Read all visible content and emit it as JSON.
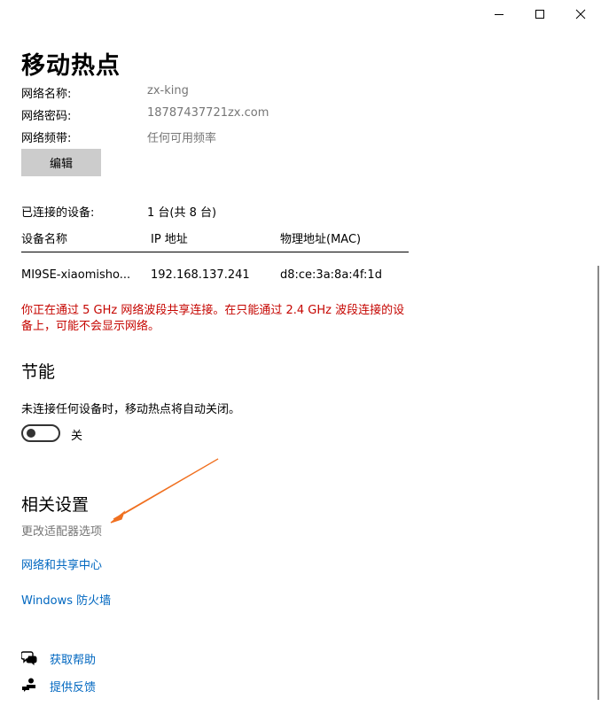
{
  "window": {
    "controls": {
      "minimize_icon": "minimize-icon",
      "maximize_icon": "maximize-icon",
      "close_icon": "close-icon"
    }
  },
  "page": {
    "title": "移动热点"
  },
  "network": {
    "name_label": "网络名称:",
    "name_value": "zx-king",
    "password_label": "网络密码:",
    "password_value": "18787437721zx.com",
    "band_label": "网络频带:",
    "band_value": "任何可用频率",
    "edit_button": "编辑"
  },
  "devices": {
    "connected_label": "已连接的设备:",
    "connected_value": "1 台(共 8 台)",
    "columns": [
      "设备名称",
      "IP 地址",
      "物理地址(MAC)"
    ],
    "rows": [
      [
        "MI9SE-xiaomisho...",
        "192.168.137.241",
        "d8:ce:3a:8a:4f:1d"
      ]
    ]
  },
  "warning": {
    "text": "你正在通过 5 GHz 网络波段共享连接。在只能通过 2.4 GHz 波段连接的设备上，可能不会显示网络。",
    "color": "#c50500"
  },
  "power_saving": {
    "heading": "节能",
    "description": "未连接任何设备时，移动热点将自动关闭。",
    "toggle_state": "关",
    "toggle_on": false
  },
  "related": {
    "heading": "相关设置",
    "adapter_options": "更改适配器选项",
    "network_center": "网络和共享中心",
    "firewall": "Windows 防火墙"
  },
  "help": {
    "get_help": "获取帮助",
    "feedback": "提供反馈"
  },
  "annotation": {
    "arrow_color": "#f07020"
  },
  "colors": {
    "link": "#0067c0",
    "secondary_text": "#767676",
    "button_bg": "#cccccc"
  }
}
